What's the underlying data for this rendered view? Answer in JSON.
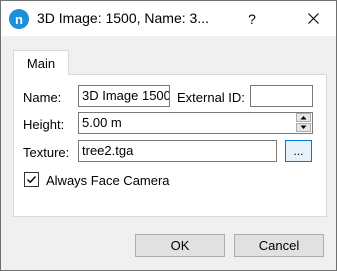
{
  "window": {
    "title": "3D Image: 1500, Name: 3...",
    "app_icon_letter": "n",
    "help_label": "?"
  },
  "tabs": [
    {
      "label": "Main",
      "selected": true
    }
  ],
  "form": {
    "name_label": "Name:",
    "name_value": "3D Image 1500",
    "external_id_label": "External ID:",
    "external_id_value": "",
    "height_label": "Height:",
    "height_value": "5.00 m",
    "texture_label": "Texture:",
    "texture_value": "tree2.tga",
    "browse_label": "...",
    "always_face_camera_label": "Always Face Camera",
    "always_face_camera_checked": true
  },
  "buttons": {
    "ok_label": "OK",
    "cancel_label": "Cancel"
  },
  "colors": {
    "accent": "#0078d7",
    "app_icon": "#1c8fd8",
    "dialog_bg": "#f0f0f0"
  }
}
